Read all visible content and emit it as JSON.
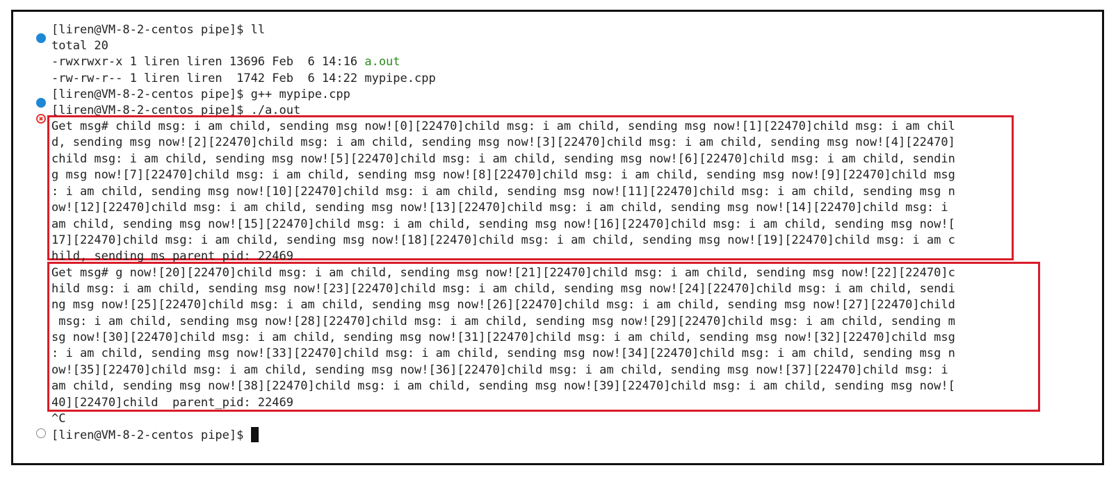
{
  "terminal": {
    "prompt": "[liren@VM-8-2-centos pipe]$ ",
    "commands": {
      "ls": "ll",
      "compile": "g++ mypipe.cpp",
      "run": "./a.out",
      "interrupt": "^C"
    },
    "ls_output": {
      "total": "total 20",
      "files": [
        {
          "meta": "-rwxrwxr-x 1 liren liren 13696 Feb  6 14:16 ",
          "name": "a.out",
          "color": "#2e8b1e"
        },
        {
          "meta": "-rw-rw-r-- 1 liren liren  1742 Feb  6 14:22 ",
          "name": "mypipe.cpp"
        }
      ]
    },
    "block1": [
      "Get msg# child msg: i am child, sending msg now![0][22470]child msg: i am child, sending msg now![1][22470]child msg: i am chil",
      "d, sending msg now![2][22470]child msg: i am child, sending msg now![3][22470]child msg: i am child, sending msg now![4][22470]",
      "child msg: i am child, sending msg now![5][22470]child msg: i am child, sending msg now![6][22470]child msg: i am child, sendin",
      "g msg now![7][22470]child msg: i am child, sending msg now![8][22470]child msg: i am child, sending msg now![9][22470]child msg",
      ": i am child, sending msg now![10][22470]child msg: i am child, sending msg now![11][22470]child msg: i am child, sending msg n",
      "ow![12][22470]child msg: i am child, sending msg now![13][22470]child msg: i am child, sending msg now![14][22470]child msg: i",
      "am child, sending msg now![15][22470]child msg: i am child, sending msg now![16][22470]child msg: i am child, sending msg now![",
      "17][22470]child msg: i am child, sending msg now![18][22470]child msg: i am child, sending msg now![19][22470]child msg: i am c",
      "hild, sending ms parent_pid: 22469"
    ],
    "block2": [
      "Get msg# g now![20][22470]child msg: i am child, sending msg now![21][22470]child msg: i am child, sending msg now![22][22470]c",
      "hild msg: i am child, sending msg now![23][22470]child msg: i am child, sending msg now![24][22470]child msg: i am child, sendi",
      "ng msg now![25][22470]child msg: i am child, sending msg now![26][22470]child msg: i am child, sending msg now![27][22470]child",
      " msg: i am child, sending msg now![28][22470]child msg: i am child, sending msg now![29][22470]child msg: i am child, sending m",
      "sg now![30][22470]child msg: i am child, sending msg now![31][22470]child msg: i am child, sending msg now![32][22470]child msg",
      ": i am child, sending msg now![33][22470]child msg: i am child, sending msg now![34][22470]child msg: i am child, sending msg n",
      "ow![35][22470]child msg: i am child, sending msg now![36][22470]child msg: i am child, sending msg now![37][22470]child msg: i",
      "am child, sending msg now![38][22470]child msg: i am child, sending msg now![39][22470]child msg: i am child, sending msg now![",
      "40][22470]child  parent_pid: 22469"
    ],
    "colors": {
      "success_marker": "#1e88d6",
      "error_marker": "#e53935",
      "highlight_box": "#d91c2a",
      "executable_file": "#2e8b1e"
    }
  }
}
